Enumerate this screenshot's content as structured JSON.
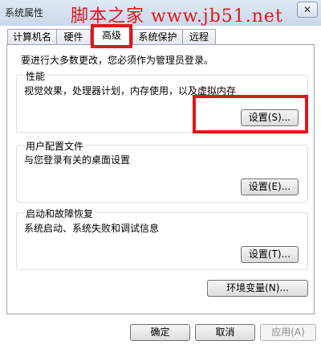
{
  "window": {
    "title": "系统属性",
    "close_glyph": "✕"
  },
  "watermark": "脚本之家 www.jb51.net",
  "tabs": [
    {
      "label": "计算机名"
    },
    {
      "label": "硬件"
    },
    {
      "label": "高级"
    },
    {
      "label": "系统保护"
    },
    {
      "label": "远程"
    }
  ],
  "admin_note": "要进行大多数更改，您必须作为管理员登录。",
  "performance": {
    "title": "性能",
    "description": "视觉效果，处理器计划，内存使用，以及虚拟内存",
    "settings_label": "设置(S)..."
  },
  "user_profiles": {
    "title": "用户配置文件",
    "description": "与您登录有关的桌面设置",
    "settings_label": "设置(E)..."
  },
  "startup_recovery": {
    "title": "启动和故障恢复",
    "description": "系统启动、系统失败和调试信息",
    "settings_label": "设置(T)..."
  },
  "env_vars_label": "环境变量(N)...",
  "footer": {
    "ok_label": "确定",
    "cancel_label": "取消",
    "apply_label": "应用(A)"
  },
  "colors": {
    "highlight": "#e0171b",
    "watermark": "#e0171b"
  }
}
